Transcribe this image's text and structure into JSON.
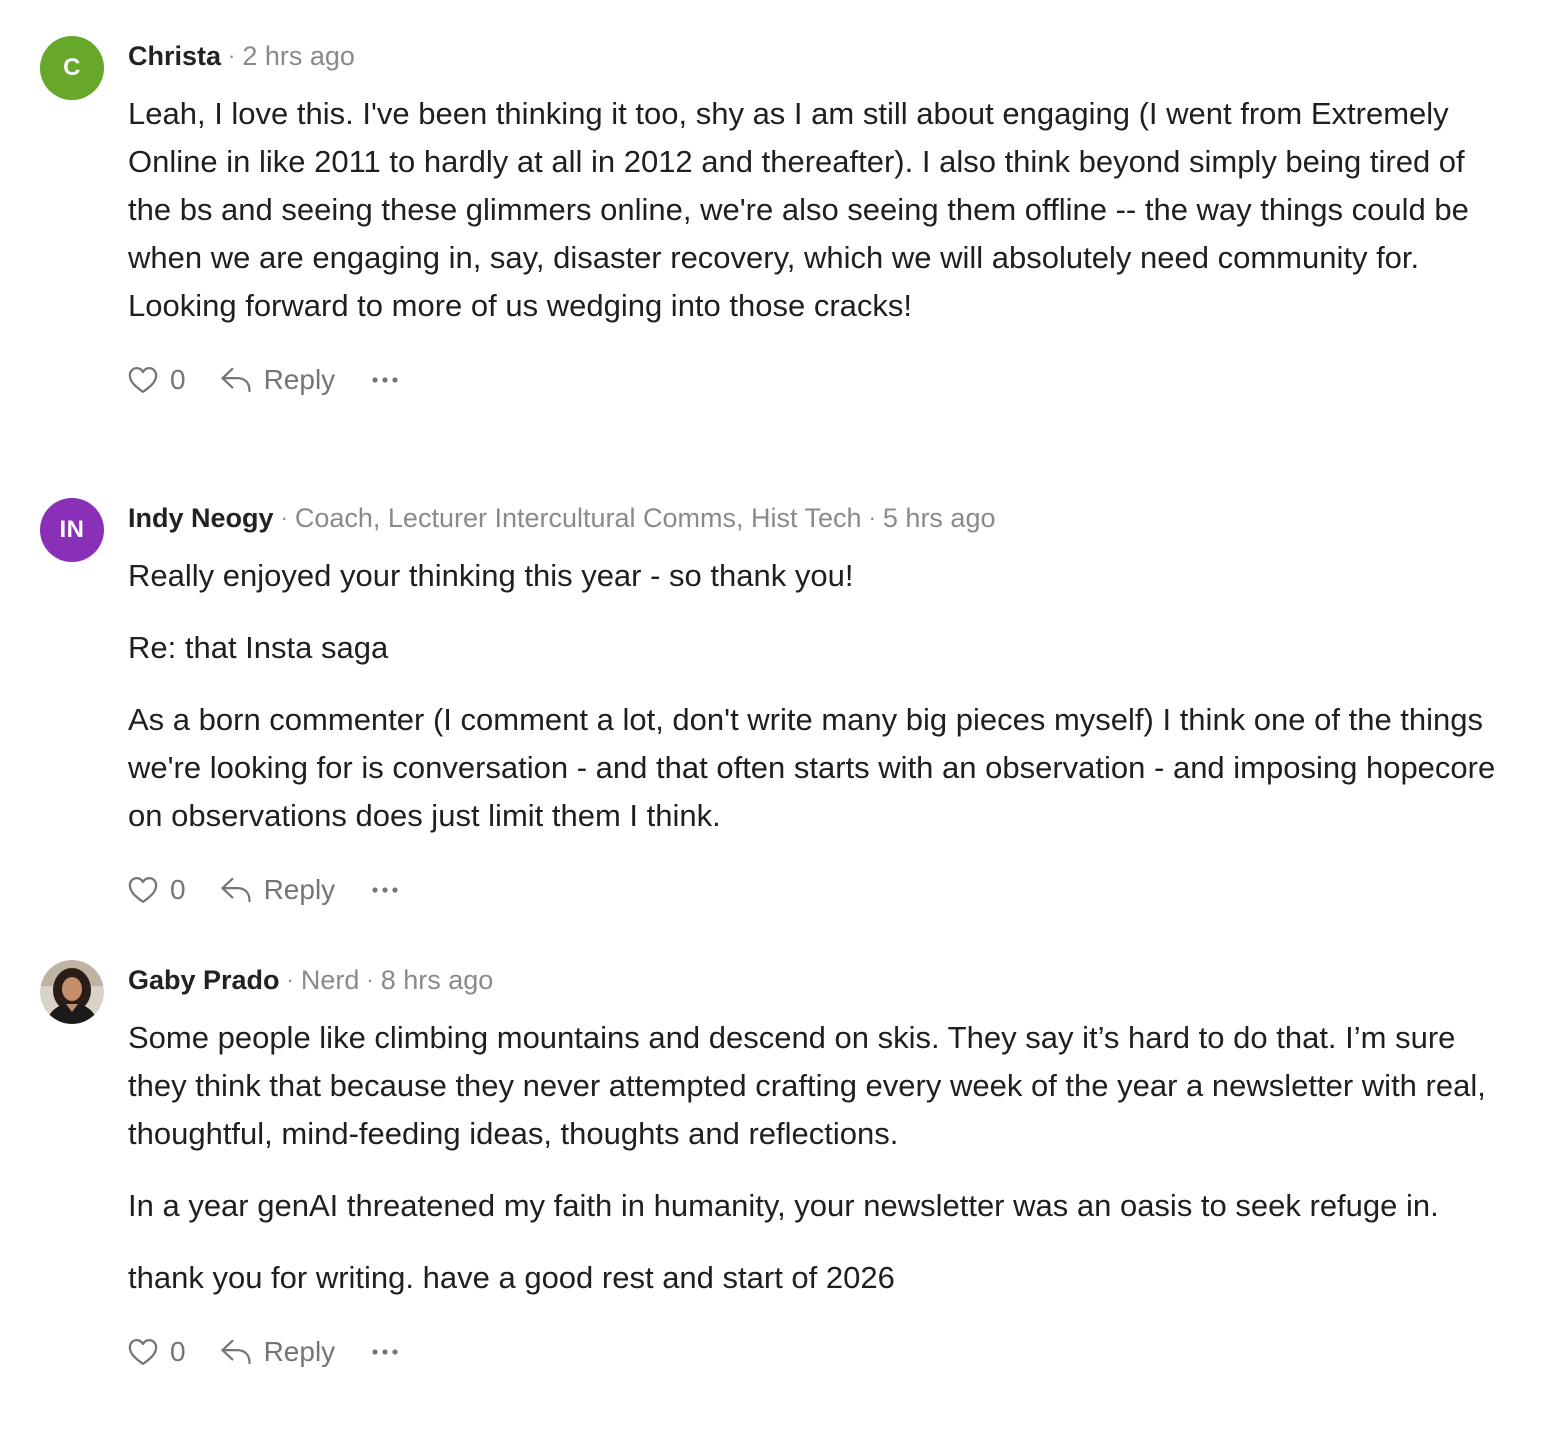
{
  "comments": [
    {
      "avatar": {
        "type": "initials",
        "initials": "C",
        "color": "#67a72a"
      },
      "author": "Christa",
      "subtitle": "",
      "time": "2 hrs ago",
      "paragraphs": [
        "Leah, I love this. I've been thinking it too, shy as I am still about engaging (I went from Extremely Online in like 2011 to hardly at all in 2012 and thereafter). I also think beyond simply being tired of the bs and seeing these glimmers online, we're also seeing them offline -- the way things could be when we are engaging in, say, disaster recovery, which we will absolutely need community for. Looking forward to more of us wedging into those cracks!"
      ],
      "likes": "0",
      "reply_label": "Reply"
    },
    {
      "avatar": {
        "type": "initials",
        "initials": "IN",
        "color": "#8a2fb8"
      },
      "author": "Indy Neogy",
      "subtitle": "Coach, Lecturer Intercultural Comms, Hist Tech",
      "time": "5 hrs ago",
      "paragraphs": [
        "Really enjoyed your thinking this year - so thank you!",
        "Re: that Insta saga",
        "As a born commenter (I comment a lot, don't write many big pieces myself) I think one of the things we're looking for is conversation - and that often starts with an observation - and imposing hopecore on observations does just limit them I think."
      ],
      "likes": "0",
      "reply_label": "Reply"
    },
    {
      "avatar": {
        "type": "photo",
        "icon": "profile-photo"
      },
      "author": "Gaby Prado",
      "subtitle": "Nerd",
      "time": "8 hrs ago",
      "paragraphs": [
        "Some people like climbing mountains and descend on skis. They say it’s hard to do that. I’m sure they think that because they never attempted crafting every week of the year a newsletter with real, thoughtful, mind-feeding ideas, thoughts and reflections.",
        "In a year genAI threatened my faith in humanity, your newsletter was an oasis to seek refuge in.",
        "thank you for writing. have a good rest and start of 2026"
      ],
      "likes": "0",
      "reply_label": "Reply"
    }
  ],
  "icons": {
    "like": "heart-icon",
    "reply": "reply-arrow-icon",
    "more": "more-options-icon"
  }
}
